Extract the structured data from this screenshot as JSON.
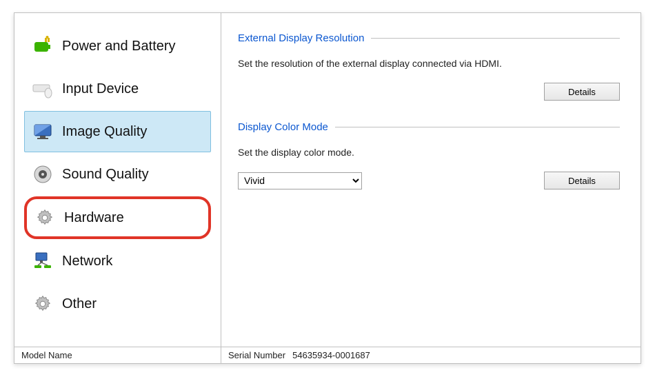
{
  "sidebar": {
    "items": [
      {
        "label": "Power and Battery"
      },
      {
        "label": "Input Device"
      },
      {
        "label": "Image Quality"
      },
      {
        "label": "Sound Quality"
      },
      {
        "label": "Hardware"
      },
      {
        "label": "Network"
      },
      {
        "label": "Other"
      }
    ]
  },
  "content": {
    "section1": {
      "title": "External Display Resolution",
      "desc": "Set the resolution of the external display connected via HDMI.",
      "button": "Details"
    },
    "section2": {
      "title": "Display Color Mode",
      "desc": "Set the display color mode.",
      "selected": "Vivid",
      "button": "Details"
    }
  },
  "statusbar": {
    "model_label": "Model Name",
    "model_value": "",
    "serial_label": "Serial Number",
    "serial_value": "54635934-0001687"
  }
}
